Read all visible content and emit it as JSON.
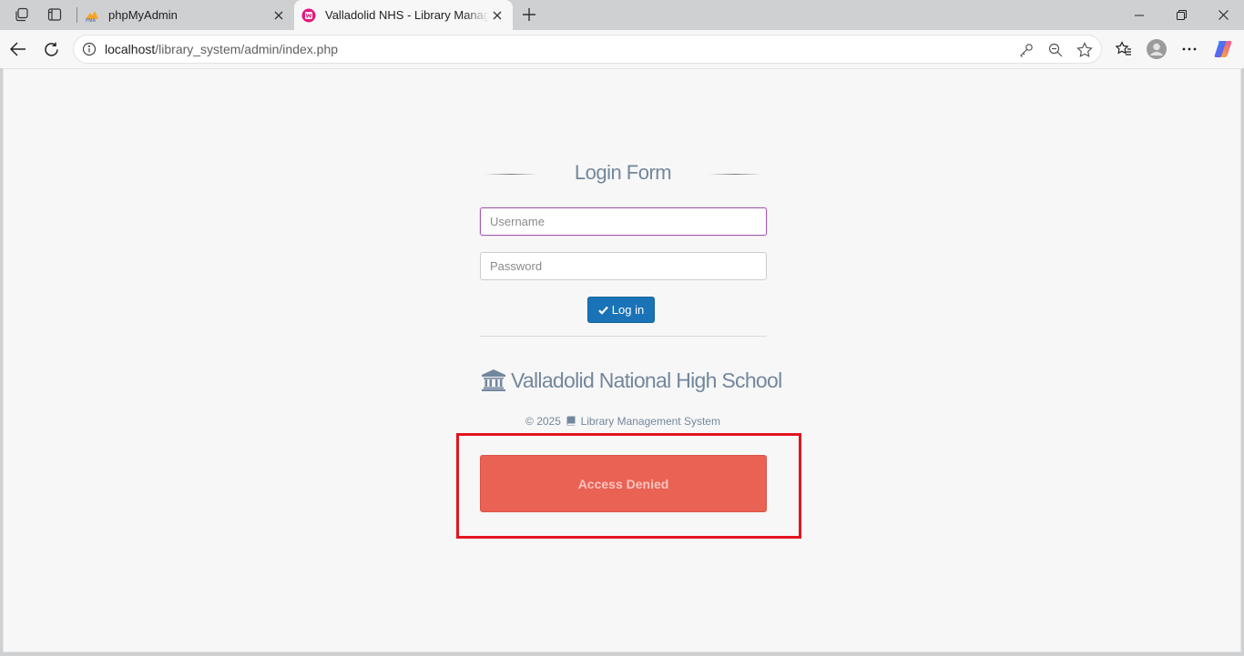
{
  "browser": {
    "tabs": [
      {
        "title": "phpMyAdmin",
        "active": false
      },
      {
        "title": "Valladolid NHS - Library Management",
        "active": true
      }
    ],
    "address": {
      "host": "localhost",
      "path": "/library_system/admin/index.php"
    }
  },
  "login": {
    "title": "Login Form",
    "username_placeholder": "Username",
    "username_value": "",
    "password_placeholder": "Password",
    "password_value": "",
    "login_button": "Log in"
  },
  "footer": {
    "school_name": "Valladolid National High School",
    "copyright_prefix": "© 2025",
    "copyright_suffix": "Library Management System"
  },
  "alert": {
    "message": "Access Denied",
    "color": "#e96254"
  },
  "colors": {
    "accent_blue": "#1a73b7",
    "text_muted": "#73879c",
    "highlight": "#e3151f"
  }
}
